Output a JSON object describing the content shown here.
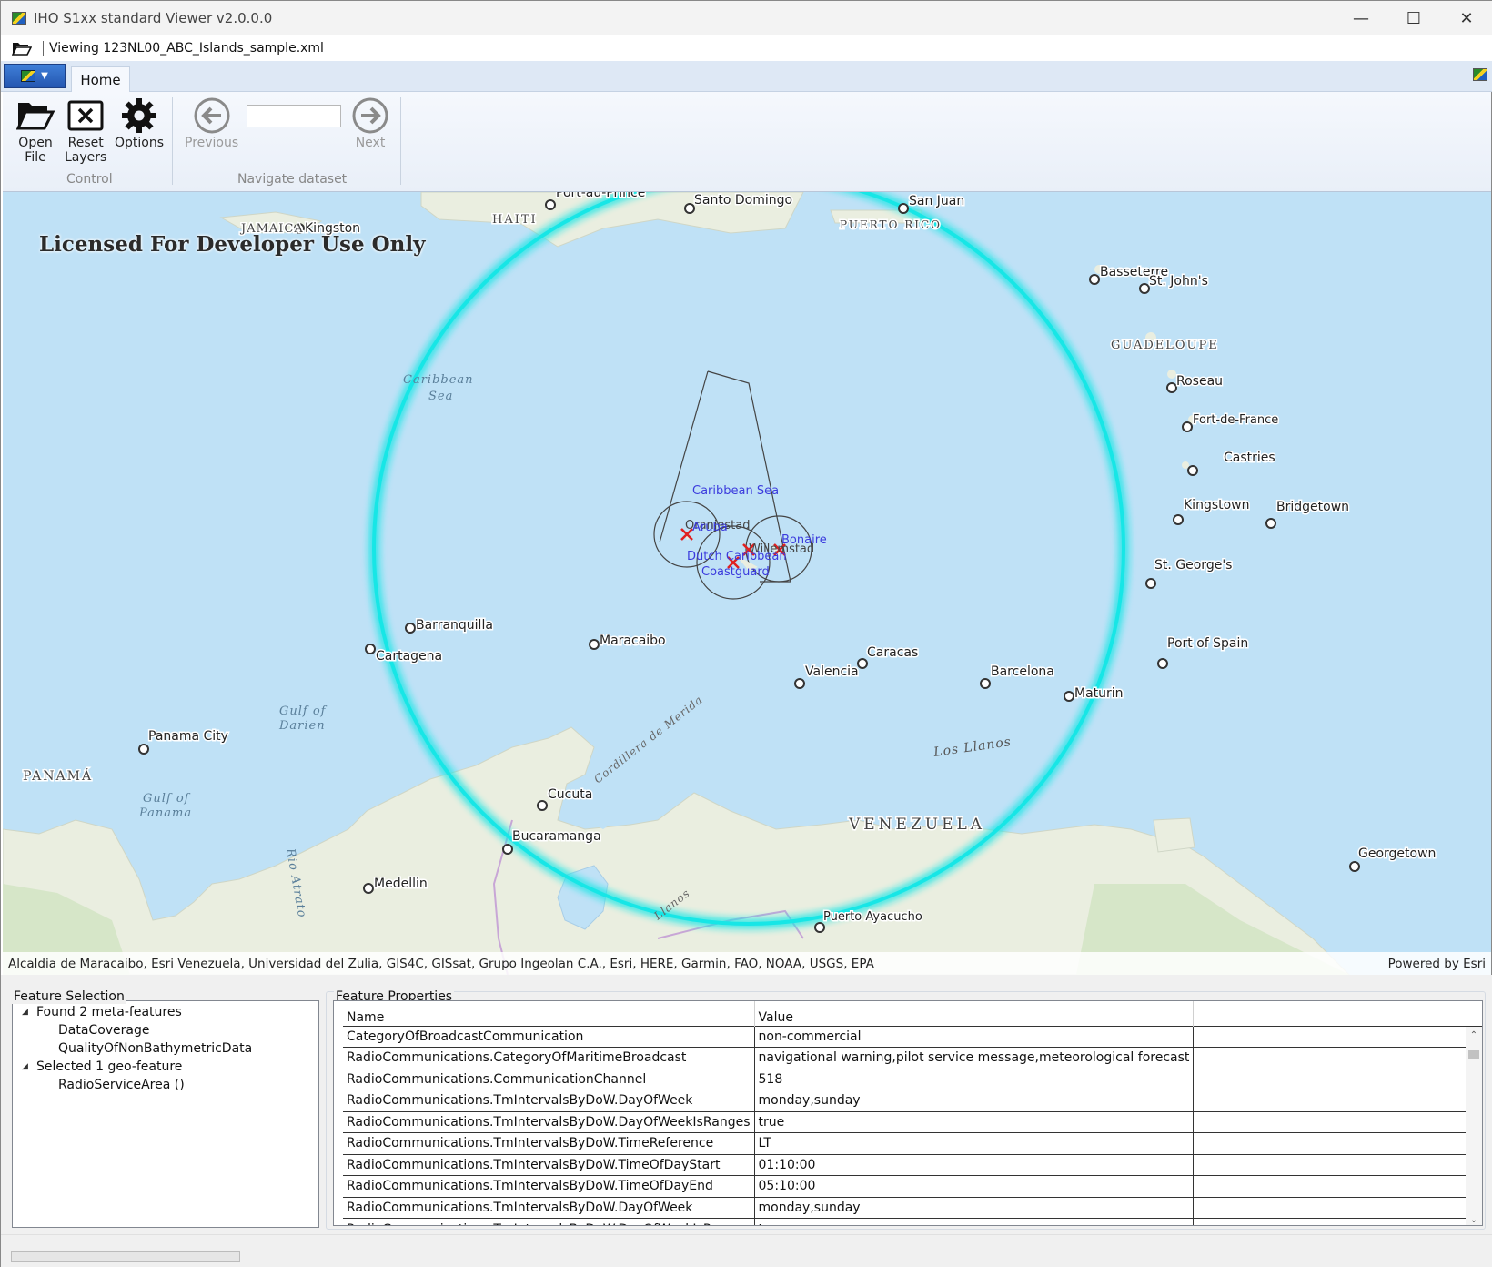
{
  "window": {
    "title": "IHO S1xx standard Viewer v2.0.0.0",
    "viewing": "Viewing 123NL00_ABC_Islands_sample.xml"
  },
  "ribbon": {
    "tab_home": "Home",
    "buttons": {
      "open_line1": "Open",
      "open_line2": "File",
      "reset_line1": "Reset",
      "reset_line2": "Layers",
      "options": "Options",
      "previous": "Previous",
      "next": "Next"
    },
    "groups": {
      "control": "Control",
      "navigate": "Navigate dataset"
    },
    "navigate_input_value": ""
  },
  "map": {
    "license": "Licensed For Developer Use Only",
    "attribution": "Alcaldia de Maracaibo, Esri Venezuela, Universidad del Zulia, GIS4C, GISsat, Grupo Ingeolan C.A., Esri, HERE, Garmin, FAO, NOAA, USGS, EPA",
    "powered_by": "Powered by Esri",
    "cities": [
      "Port-au-Prince",
      "Santo Domingo",
      "San Juan",
      "Kingston",
      "Basseterre",
      "St. John's",
      "Roseau",
      "Fort-de-France",
      "Castries",
      "Kingstown",
      "Bridgetown",
      "St. George's",
      "Port of Spain",
      "Barranquilla",
      "Cartagena",
      "Maracaibo",
      "Caracas",
      "Valencia",
      "Barcelona",
      "Maturin",
      "Panama City",
      "Cucuta",
      "Bucaramanga",
      "Medellin",
      "Georgetown",
      "Puerto Ayacucho"
    ],
    "countries": [
      "HAITI",
      "JAMAICA",
      "PUERTO RICO",
      "GUADELOUPE",
      "PANAMÁ",
      "VENEZUELA"
    ],
    "seas": [
      "Caribbean",
      "Sea",
      "Gulf of",
      "Darien",
      "Gulf of",
      "Panama",
      "Rio Atrato",
      "Los Llanos",
      "Cordillera de Merida",
      "Llanos"
    ],
    "features": [
      "Caribbean Sea",
      "Oranjestad",
      "Aruba",
      "Willemstad",
      "Bonaire",
      "Dutch Caribbean",
      "Coastguard"
    ]
  },
  "feature_selection": {
    "title": "Feature Selection",
    "meta_header": "Found 2 meta-features",
    "meta_items": [
      "DataCoverage",
      "QualityOfNonBathymetricData"
    ],
    "geo_header": "Selected 1 geo-feature",
    "geo_items": [
      "RadioServiceArea ()"
    ]
  },
  "feature_properties": {
    "title": "Feature Properties",
    "columns": [
      "Name",
      "Value"
    ],
    "rows": [
      {
        "name": "CategoryOfBroadcastCommunication",
        "value": "non-commercial"
      },
      {
        "name": "RadioCommunications.CategoryOfMaritimeBroadcast",
        "value": "navigational warning,pilot service message,meteorological forecast"
      },
      {
        "name": "RadioCommunications.CommunicationChannel",
        "value": "518"
      },
      {
        "name": "RadioCommunications.TmIntervalsByDoW.DayOfWeek",
        "value": "monday,sunday"
      },
      {
        "name": "RadioCommunications.TmIntervalsByDoW.DayOfWeekIsRanges",
        "value": "true"
      },
      {
        "name": "RadioCommunications.TmIntervalsByDoW.TimeReference",
        "value": "LT"
      },
      {
        "name": "RadioCommunications.TmIntervalsByDoW.TimeOfDayStart",
        "value": "01:10:00"
      },
      {
        "name": "RadioCommunications.TmIntervalsByDoW.TimeOfDayEnd",
        "value": "05:10:00"
      },
      {
        "name": "RadioCommunications.TmIntervalsByDoW.DayOfWeek",
        "value": "monday,sunday"
      },
      {
        "name": "RadioCommunications.TmIntervalsByDoW.DayOfWeekIsRanges",
        "value": "true"
      }
    ]
  },
  "colors": {
    "sea": "#bfe1f6",
    "land": "#eeeee6",
    "highlight_circle": "#17e6e6",
    "feature_label": "#3b3bdd",
    "ribbon_accent": "#2456b0"
  }
}
